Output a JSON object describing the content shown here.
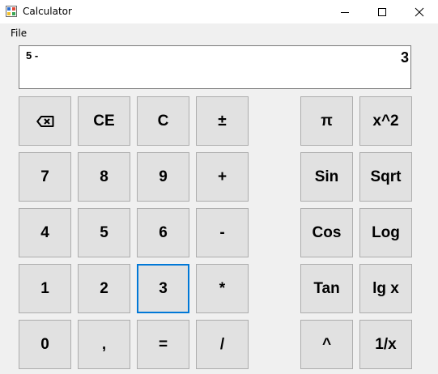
{
  "window": {
    "title": "Calculator"
  },
  "menu": {
    "file": "File"
  },
  "display": {
    "expression": "5 -",
    "value": "3"
  },
  "buttons": {
    "ce": "CE",
    "c": "C",
    "plusminus": "±",
    "pi": "π",
    "square": "x^2",
    "d7": "7",
    "d8": "8",
    "d9": "9",
    "plus": "+",
    "sin": "Sin",
    "sqrt": "Sqrt",
    "d4": "4",
    "d5": "5",
    "d6": "6",
    "minus": "-",
    "cos": "Cos",
    "log": "Log",
    "d1": "1",
    "d2": "2",
    "d3": "3",
    "multiply": "*",
    "tan": "Tan",
    "lgx": "lg x",
    "d0": "0",
    "comma": ",",
    "equals": "=",
    "divide": "/",
    "power": "^",
    "reciprocal": "1/x"
  },
  "icons": {
    "backspace": "backspace-icon",
    "app": "calculator-app-icon"
  },
  "colors": {
    "focus": "#0078d7",
    "button_bg": "#e1e1e1"
  }
}
